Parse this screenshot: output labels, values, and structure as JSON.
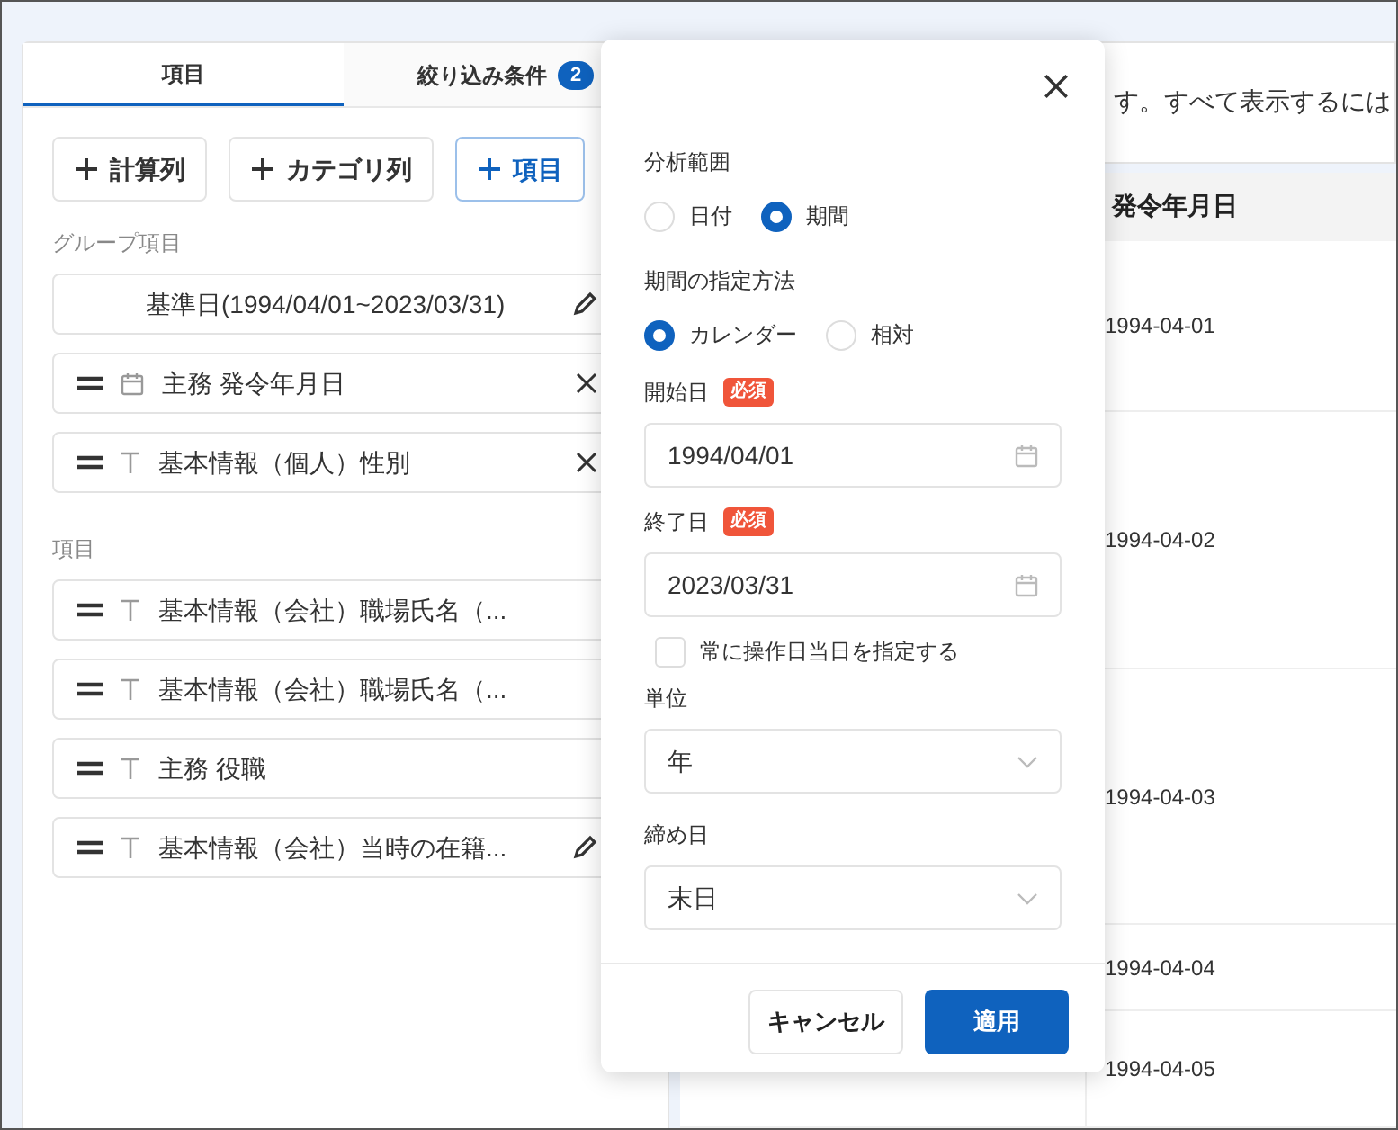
{
  "tabs": [
    {
      "label": "項目",
      "selected": true
    },
    {
      "label": "絞り込み条件",
      "badge": "2",
      "selected": false
    }
  ],
  "toolbar_buttons": [
    {
      "label": "計算列",
      "kind": "default"
    },
    {
      "label": "カテゴリ列",
      "kind": "default"
    },
    {
      "label": "項目",
      "kind": "primary"
    }
  ],
  "group_section": {
    "label": "グループ項目",
    "items": [
      {
        "kind": "period",
        "label": "基準日(1994/04/01~2023/03/31)",
        "action": {
          "kind": "edit"
        }
      },
      {
        "kind": "date",
        "label": "主務 発令年月日",
        "action": {
          "kind": "remove"
        }
      },
      {
        "kind": "text",
        "label": "基本情報（個人）性別",
        "action": {
          "kind": "remove"
        }
      }
    ]
  },
  "items_section": {
    "label": "項目",
    "items": [
      {
        "kind": "text",
        "label": "基本情報（会社）職場氏名（..."
      },
      {
        "kind": "text",
        "label": "基本情報（会社）職場氏名（..."
      },
      {
        "kind": "text",
        "label": "主務 役職"
      },
      {
        "kind": "text",
        "label": "基本情報（会社）当時の在籍...",
        "action": {
          "kind": "edit"
        }
      }
    ]
  },
  "table": {
    "notice": "す。すべて表示するには",
    "columns": [
      "発令年月日"
    ],
    "rows": [
      {
        "date": "1994-04-01"
      },
      {
        "date": "1994-04-02"
      },
      {
        "date": "1994-04-03"
      },
      {
        "date": "1994-04-04"
      },
      {
        "date": "1994-04-05"
      }
    ]
  },
  "dialog": {
    "analysis_range": {
      "label": "分析範囲",
      "options": [
        {
          "label": "日付",
          "selected": false
        },
        {
          "label": "期間",
          "selected": true
        }
      ]
    },
    "period_method": {
      "label": "期間の指定方法",
      "options": [
        {
          "label": "カレンダー",
          "selected": true
        },
        {
          "label": "相対",
          "selected": false
        }
      ]
    },
    "start_date": {
      "label": "開始日",
      "badge": "必須",
      "value": "1994/04/01"
    },
    "end_date": {
      "label": "終了日",
      "badge": "必須",
      "value": "2023/03/31"
    },
    "always_today": {
      "label": "常に操作日当日を指定する",
      "checked": false
    },
    "unit": {
      "label": "単位",
      "value": "年"
    },
    "closing_day": {
      "label": "締め日",
      "value": "末日"
    },
    "buttons": [
      {
        "label": "キャンセル",
        "kind": "secondary"
      },
      {
        "label": "適用",
        "kind": "primary"
      }
    ]
  }
}
